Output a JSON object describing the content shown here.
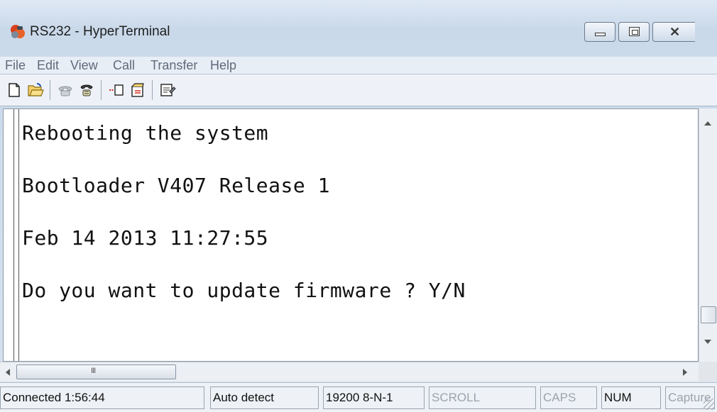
{
  "window": {
    "title": "RS232 - HyperTerminal",
    "app_icon": "hyperterminal-icon",
    "controls": [
      "minimize-icon",
      "maximize-icon",
      "close-icon"
    ]
  },
  "menu": [
    "File",
    "Edit",
    "View",
    "Call",
    "Transfer",
    "Help"
  ],
  "toolbar": {
    "buttons": [
      "new-document-icon",
      "open-folder-icon",
      "connect-phone-icon",
      "disconnect-icon",
      "send-icon",
      "receive-icon",
      "properties-icon"
    ]
  },
  "terminal": {
    "lines": [
      "Rebooting the system",
      "Bootloader V407 Release 1",
      "Feb 14 2013 11:27:55",
      "Do you want to update firmware ? Y/N"
    ]
  },
  "scrollbars": {
    "h_thumb_grip": "III"
  },
  "status": {
    "connected": "Connected 1:56:44",
    "detect": "Auto detect",
    "settings": "19200 8-N-1",
    "scroll": "SCROLL",
    "caps": "CAPS",
    "num": "NUM",
    "capture": "Capture"
  },
  "colors": {
    "chrome": "#d6e2ef",
    "terminal_bg": "#ffffff",
    "terminal_text": "#111111",
    "status_dim": "#9aa3ad"
  }
}
